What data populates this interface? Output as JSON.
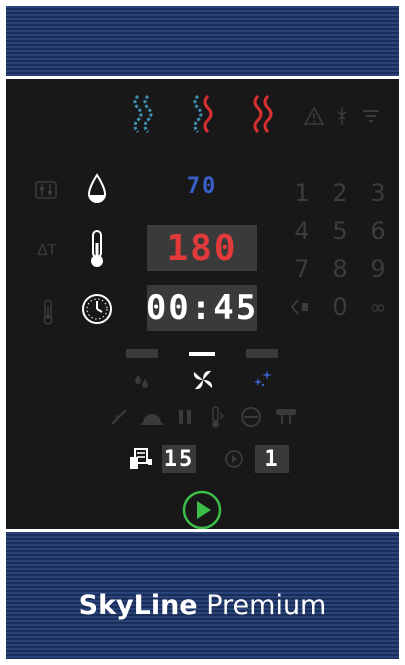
{
  "displays": {
    "humidity": "70",
    "temperature": "180",
    "time": "00:45",
    "fan_speed_indicator": "-",
    "cycles": "15",
    "program": "1"
  },
  "keypad": {
    "digits": [
      "1",
      "2",
      "3",
      "4",
      "5",
      "6",
      "7",
      "8",
      "9"
    ],
    "zero": "0",
    "infinity": "∞"
  },
  "brand": {
    "name_bold": "SkyLine",
    "name_light": "Premium"
  },
  "colors": {
    "panel": "#181818",
    "band": "#22396a",
    "accent_blue": "#3a5fc8",
    "accent_red": "#e23a3a",
    "start_green": "#3bbf4a",
    "dim": "#3a3a3a"
  },
  "icons": {
    "steam": "steam-icon",
    "combi": "combi-icon",
    "convection": "convection-icon",
    "warning": "warning-icon",
    "humidity": "water-drop-icon",
    "temperature": "thermometer-icon",
    "timer": "clock-icon",
    "fan": "fan-icon",
    "start": "play-icon"
  }
}
